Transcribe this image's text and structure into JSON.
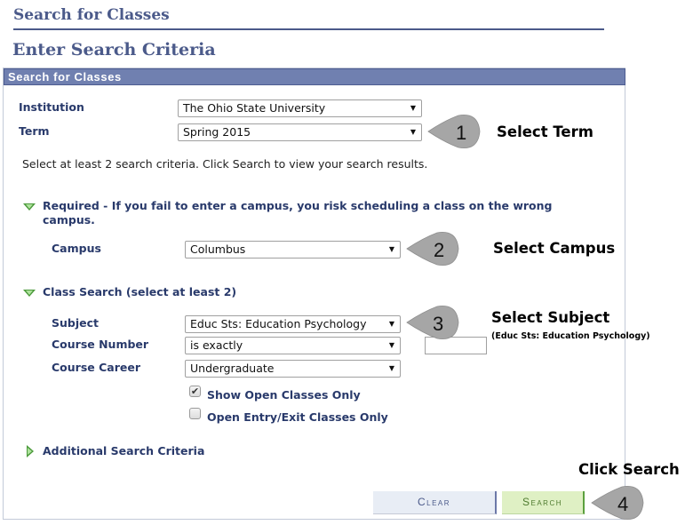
{
  "page": {
    "title": "Search for Classes",
    "subtitle": "Enter Search Criteria",
    "panel_header": "Search for Classes"
  },
  "form": {
    "institution": {
      "label": "Institution",
      "value": "The Ohio State University"
    },
    "term": {
      "label": "Term",
      "value": "Spring 2015"
    },
    "instructions": "Select at least 2 search criteria. Click Search to view your search results.",
    "required_section": {
      "label_line1": "Required - If you fail to enter a campus, you risk scheduling a class on the wrong",
      "label_line2": "campus.",
      "expanded": true
    },
    "campus": {
      "label": "Campus",
      "value": "Columbus"
    },
    "class_search_section": {
      "label": "Class Search (select at least 2)",
      "expanded": true
    },
    "subject": {
      "label": "Subject",
      "value": "Educ Sts: Education Psychology"
    },
    "course_number": {
      "label": "Course Number",
      "operator": "is exactly",
      "value": ""
    },
    "course_career": {
      "label": "Course Career",
      "value": "Undergraduate"
    },
    "show_open_only": {
      "label": "Show Open Classes Only",
      "checked": true
    },
    "open_entry_exit": {
      "label": "Open Entry/Exit Classes Only",
      "checked": false
    },
    "additional_section": {
      "label": "Additional Search Criteria",
      "expanded": false
    }
  },
  "buttons": {
    "clear": "Clear",
    "search": "Search"
  },
  "icons": {
    "dropdown": "▼",
    "check": "✔"
  },
  "callouts": [
    {
      "number": "1",
      "text": "Select Term"
    },
    {
      "number": "2",
      "text": "Select Campus"
    },
    {
      "number": "3",
      "text": "Select Subject",
      "subtext": "(Educ Sts: Education Psychology)"
    },
    {
      "number": "4",
      "text": "Click Search"
    }
  ],
  "colors": {
    "header_text": "#4b5a8a",
    "panel_header_bg": "#7080b0",
    "label_text": "#293a6b",
    "expand_icon": "#4c9a3c",
    "callout_fill": "#a6a6a6"
  }
}
